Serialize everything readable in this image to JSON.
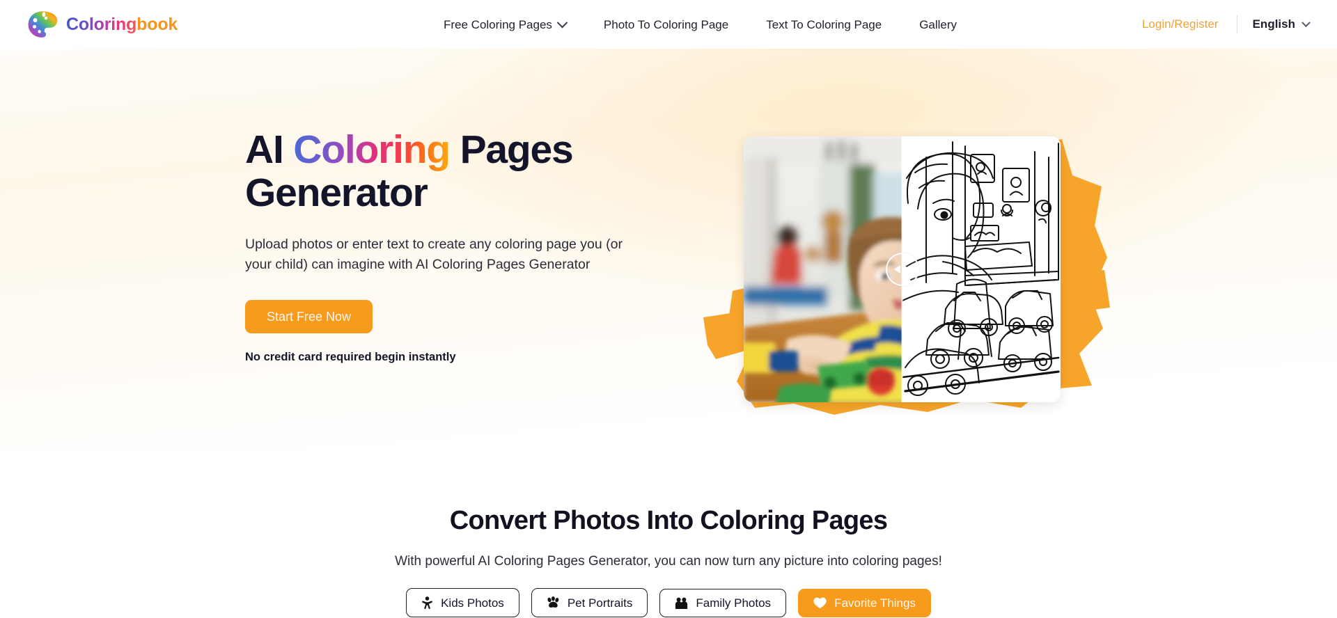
{
  "header": {
    "brand": {
      "word1": "Coloring",
      "word2": "book",
      "icon": "palette-icon"
    },
    "nav": [
      {
        "label": "Free Coloring Pages",
        "has_dropdown": true
      },
      {
        "label": "Photo To Coloring Page",
        "has_dropdown": false
      },
      {
        "label": "Text To Coloring Page",
        "has_dropdown": false
      },
      {
        "label": "Gallery",
        "has_dropdown": false
      }
    ],
    "login_label": "Login/Register",
    "language_label": "English",
    "accent_color": "#f5941f",
    "login_color": "#f0a33c"
  },
  "hero": {
    "title_part1": "AI ",
    "title_highlight": "Coloring",
    "title_part2": " Pages Generator",
    "subtitle": "Upload photos or enter text to create any coloring page you (or your child) can imagine with AI Coloring Pages Generator",
    "cta_label": "Start Free Now",
    "cta_note": "No credit card required begin instantly",
    "cta_color": "#f89a1c",
    "brush_color": "#f7a52a",
    "comparison": {
      "left_caption": "photo of child playing with toy cars",
      "right_caption": "line-art coloring page of the same scene",
      "handle_position_percent": 50
    }
  },
  "section2": {
    "title": "Convert Photos Into Coloring Pages",
    "subtitle": "With powerful AI Coloring Pages Generator, you can now turn any picture into coloring pages!",
    "filters": [
      {
        "label": "Kids Photos",
        "icon": "child-icon",
        "active": false
      },
      {
        "label": "Pet Portraits",
        "icon": "paw-icon",
        "active": false
      },
      {
        "label": "Family Photos",
        "icon": "people-icon",
        "active": false
      },
      {
        "label": "Favorite Things",
        "icon": "heart-icon",
        "active": true
      }
    ]
  }
}
